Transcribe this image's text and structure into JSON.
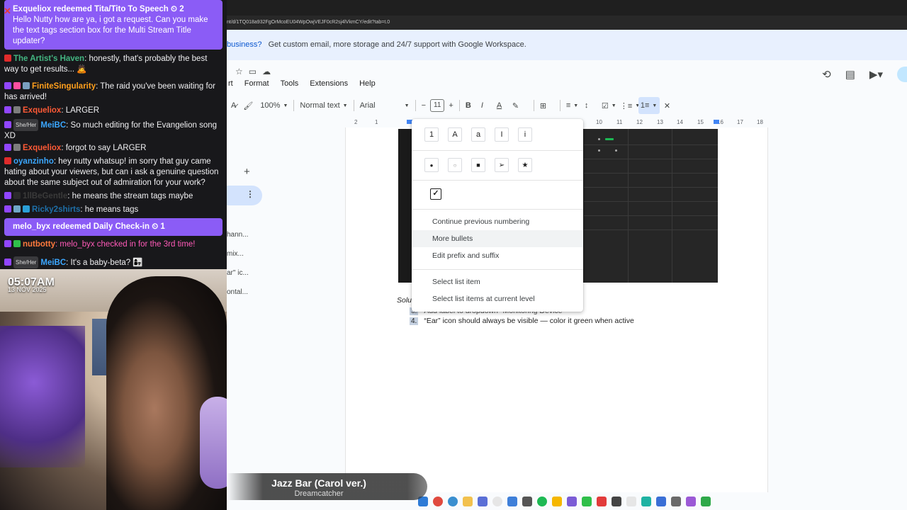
{
  "browser": {
    "url": "nt/d/1TQ018a932FgOrMcoEU04WpOwjVEJF0cR2sj4lVkmCY/edit?tab=t.0",
    "promo_bold": "business?",
    "promo_text": "Get custom email, more storage and 24/7 support with Google Workspace.",
    "menus": [
      "rt",
      "Format",
      "Tools",
      "Extensions",
      "Help"
    ]
  },
  "toolbar": {
    "zoom": "100%",
    "style": "Normal text",
    "font": "Arial",
    "minus": "−",
    "font_size": "11",
    "plus": "+",
    "bold": "B",
    "italic": "I",
    "underline_color": "A",
    "align": "≡",
    "clear": "✕"
  },
  "ruler": [
    "2",
    "1",
    "10",
    "11",
    "12",
    "13",
    "14",
    "15",
    "16",
    "17",
    "18"
  ],
  "left_panel": {
    "plus": "+",
    "kebab": "⋮",
    "outline": [
      "hann...",
      "mix...",
      "ar\" ic...",
      "ontal..."
    ]
  },
  "dropdown": {
    "numbering_options": [
      "1",
      "A",
      "a",
      "I",
      "i"
    ],
    "bullet_options": [
      "●",
      "○",
      "■",
      "➢",
      "★"
    ],
    "checkbox": "✓",
    "items": [
      "Continue previous numbering",
      "More bullets",
      "Edit prefix and suffix",
      "Select list item",
      "Select list items at current level"
    ]
  },
  "doc": {
    "solu": "Solu",
    "item3_num": "3.",
    "item3_text": "Add label to dropdown \"Monitoring Device\"",
    "item4_num": "4.",
    "item4_text": "“Ear” icon should always be visible — color it green when active"
  },
  "music": {
    "song": "Jazz Bar (Carol ver.)",
    "artist": "Dreamcatcher"
  },
  "cam": {
    "time": "05:07AM",
    "date": "13 NOV 2025"
  },
  "chat": {
    "redeem1_header": "Exqueliox redeemed Tita/Tito To Speech ⏲ 2",
    "redeem1_text": "Hello Nutty how are ya, i got a request. Can you make the text tags section box for the Multi Stream Title updater?",
    "redeem2_header": "melo_byx redeemed Daily Check-in ⏲ 1",
    "messages": [
      {
        "pronoun": "",
        "nick": "The Artist's Haven",
        "color": "#43b581",
        "text": ": honestly, that's probably the best way to get results... 🙇"
      },
      {
        "pronoun": "",
        "nick": "FiniteSingularity",
        "color": "#ff9f1c",
        "text": ": The raid you've been waiting for has arrived!"
      },
      {
        "pronoun": "",
        "nick": "Exqueliox",
        "color": "#ff5a36",
        "text": ": LARGER"
      },
      {
        "pronoun": "She/Her",
        "nick": "MeiBC",
        "color": "#3ba7ff",
        "text": ": So much editing for the Evangelion song XD"
      },
      {
        "pronoun": "",
        "nick": "Exqueliox",
        "color": "#ff5a36",
        "text": ": forgot to say LARGER"
      },
      {
        "pronoun": "",
        "nick": "oyanzinho",
        "color": "#3ba7ff",
        "text": ": hey nutty whatsup! im sorry that guy came hating about your viewers, but can i ask a genuine question about the same subject out of admiration for your work?"
      },
      {
        "pronoun": "",
        "nick": "1llBeGentle",
        "color": "#3a3a3a",
        "text": ": he means the stream tags maybe"
      },
      {
        "pronoun": "",
        "nick": "Ricky2shirts",
        "color": "#1e6fa8",
        "text": ": he means tags"
      },
      {
        "pronoun": "",
        "nick": "nutbotty",
        "color": "#ff7a3d",
        "text": ": melo_byx checked in for the 3rd time!",
        "text_color": "#ff5ab8"
      },
      {
        "pronoun": "She/Her",
        "nick": "MeiBC",
        "color": "#3ba7ff",
        "text": ": It's a baby-beta? 👩‍👧"
      }
    ]
  },
  "colors": {
    "twitch_purple": "#8b5cf6",
    "docs_blue": "#0b57d0",
    "chat_bg": "#18181b"
  }
}
